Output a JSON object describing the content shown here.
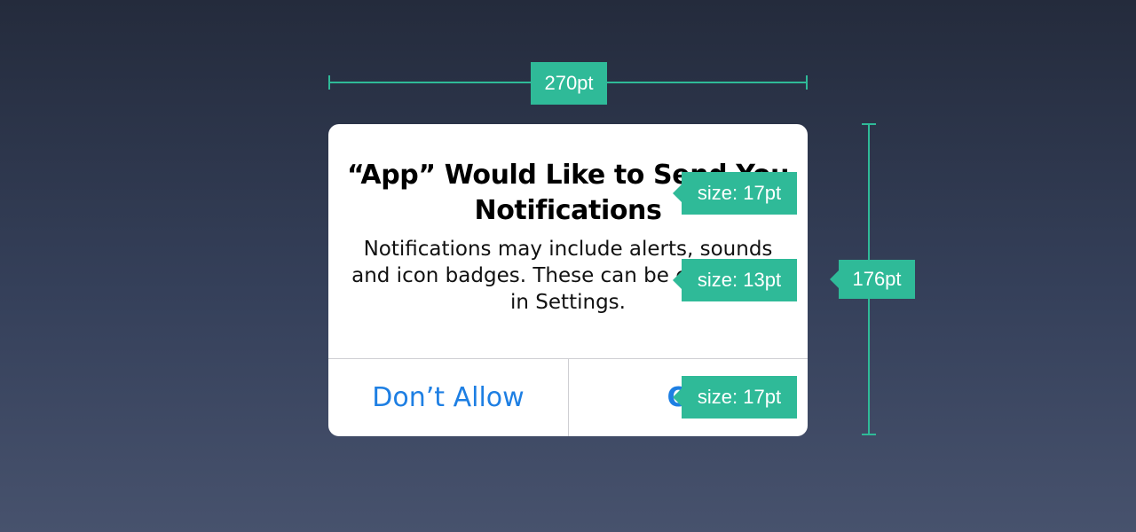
{
  "alert": {
    "title": "“App” Would Like to Send You Notifications",
    "message": "Notifications may include alerts, sounds and icon badges. These can be configured in Settings.",
    "buttons": {
      "dont_allow": "Don’t Allow",
      "ok": "OK"
    }
  },
  "annotations": {
    "width_label": "270pt",
    "height_label": "176pt",
    "title_size": "size: 17pt",
    "message_size": "size: 13pt",
    "button_size": "size: 17pt"
  },
  "colors": {
    "accent": "#2fba98",
    "button_blue": "#1e7fe3",
    "background_top": "#242b3c",
    "background_bottom": "#47526d",
    "card": "#ffffff"
  }
}
